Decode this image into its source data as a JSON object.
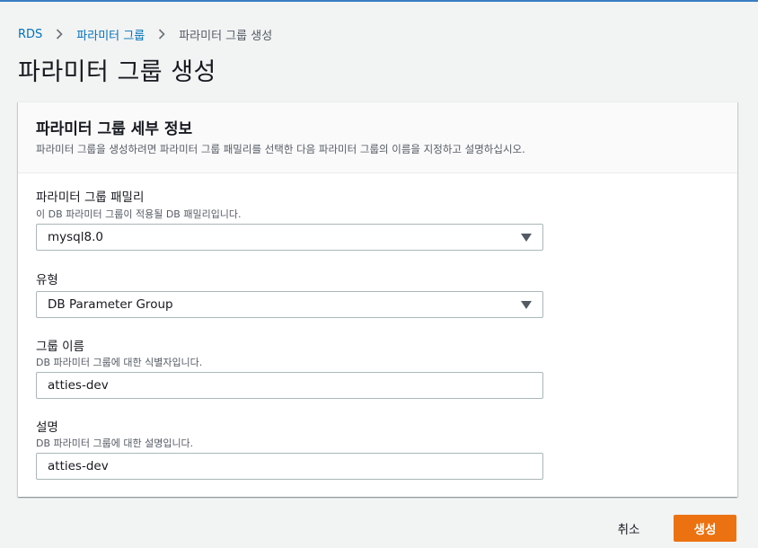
{
  "breadcrumb": {
    "items": [
      "RDS",
      "파라미터 그룹"
    ],
    "current": "파라미터 그룹 생성",
    "separator_icon": "chevron-right-icon"
  },
  "page": {
    "title": "파라미터 그룹 생성"
  },
  "panel": {
    "title": "파라미터 그룹 세부 정보",
    "description": "파라미터 그룹을 생성하려면 파라미터 그룹 패밀리를 선택한 다음 파라미터 그룹의 이름을 지정하고 설명하십시오."
  },
  "fields": {
    "family": {
      "label": "파라미터 그룹 패밀리",
      "description": "이 DB 파라미터 그룹이 적용될 DB 패밀리입니다.",
      "value": "mysql8.0"
    },
    "type": {
      "label": "유형",
      "value": "DB Parameter Group"
    },
    "group_name": {
      "label": "그룹 이름",
      "description": "DB 파라미터 그룹에 대한 식별자입니다.",
      "value": "atties-dev"
    },
    "description": {
      "label": "설명",
      "description": "DB 파라미터 그룹에 대한 설명입니다.",
      "value": "atties-dev"
    }
  },
  "actions": {
    "cancel_label": "취소",
    "create_label": "생성"
  },
  "colors": {
    "primary_button": "#ec7211",
    "link": "#0073bb",
    "top_bar": "#3a7ec2"
  }
}
